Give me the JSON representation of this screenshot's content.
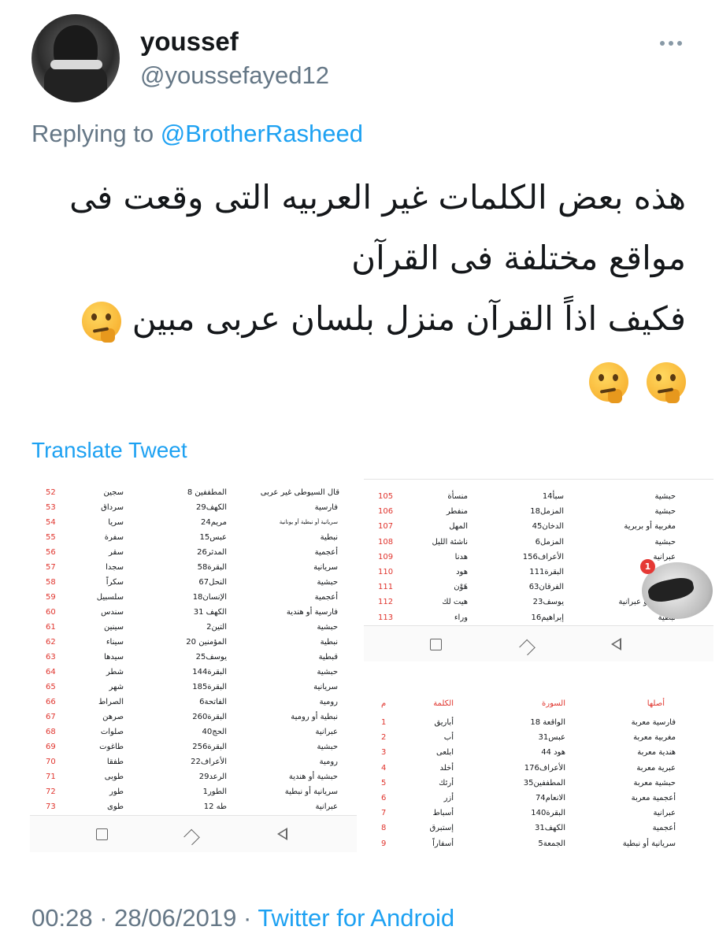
{
  "header": {
    "name": "youssef",
    "handle": "@youssefayed12"
  },
  "reply": {
    "prefix": "Replying to",
    "to": "@BrotherRasheed"
  },
  "tweet": {
    "line1": "هذه بعض الكلمات غير العربيه التى وقعت فى",
    "line2": "مواقع مختلفة فى القرآن",
    "line3": "فكيف اذاً القرآن منزل بلسان عربى مبين",
    "emoji": "thinking-face"
  },
  "translate_label": "Translate Tweet",
  "footer": {
    "time": "00:28",
    "date": "28/06/2019",
    "source": "Twitter for Android",
    "separator": "·"
  },
  "shot_left": {
    "header_note": "قال السيوطى غير عربى",
    "rows": [
      {
        "n": "52",
        "w": "سجين",
        "s": "المطففين 8",
        "o": ""
      },
      {
        "n": "53",
        "w": "سرداق",
        "s": "الكهف29",
        "o": "فارسية"
      },
      {
        "n": "54",
        "w": "سريا",
        "s": "مريم24",
        "o": "سريانية أو نبطية أو يونانية"
      },
      {
        "n": "55",
        "w": "سفرة",
        "s": "عبس15",
        "o": "نبطية"
      },
      {
        "n": "56",
        "w": "سقر",
        "s": "المدثر26",
        "o": "أعجمية"
      },
      {
        "n": "57",
        "w": "سجدا",
        "s": "البقرة58",
        "o": "سريانية"
      },
      {
        "n": "58",
        "w": "سكراً",
        "s": "النحل67",
        "o": "حبشية"
      },
      {
        "n": "59",
        "w": "سلسبيل",
        "s": "الإنسان18",
        "o": "أعجمية"
      },
      {
        "n": "60",
        "w": "سندس",
        "s": "الكهف 31",
        "o": "فارسية أو هندية"
      },
      {
        "n": "61",
        "w": "سينين",
        "s": "التين2",
        "o": "حبشية"
      },
      {
        "n": "62",
        "w": "سيناء",
        "s": "المؤمنين 20",
        "o": "نبطية"
      },
      {
        "n": "63",
        "w": "سيدها",
        "s": "يوسف25",
        "o": "قبطية"
      },
      {
        "n": "64",
        "w": "شطر",
        "s": "البقرة144",
        "o": "حبشية"
      },
      {
        "n": "65",
        "w": "شهر",
        "s": "البقرة185",
        "o": "سريانية"
      },
      {
        "n": "66",
        "w": "الصراط",
        "s": "الفاتحة6",
        "o": "رومية"
      },
      {
        "n": "67",
        "w": "صرهن",
        "s": "البقرة260",
        "o": "نبطية أو رومية"
      },
      {
        "n": "68",
        "w": "صلوات",
        "s": "الحج40",
        "o": "عبرانية"
      },
      {
        "n": "69",
        "w": "طاغوت",
        "s": "البقرة256",
        "o": "حبشية"
      },
      {
        "n": "70",
        "w": "طفقا",
        "s": "الأعراف22",
        "o": "رومية"
      },
      {
        "n": "71",
        "w": "طوبى",
        "s": "الرعد29",
        "o": "حبشية أو هندية"
      },
      {
        "n": "72",
        "w": "طور",
        "s": "الطور1",
        "o": "سريانية أو نبطية"
      },
      {
        "n": "73",
        "w": "طوى",
        "s": "طه 12",
        "o": "عبرانية"
      }
    ]
  },
  "shot_top_right": {
    "rows": [
      {
        "n": "105",
        "w": "منسأة",
        "s": "سبأ14",
        "o": "حبشية"
      },
      {
        "n": "106",
        "w": "منفطر",
        "s": "المزمل18",
        "o": "حبشية"
      },
      {
        "n": "107",
        "w": "المهل",
        "s": "الدخان45",
        "o": "مغربية أو بربرية"
      },
      {
        "n": "108",
        "w": "ناشئة الليل",
        "s": "المزمل6",
        "o": "حبشية"
      },
      {
        "n": "109",
        "w": "هدنا",
        "s": "الأعراف156",
        "o": "عبرانية"
      },
      {
        "n": "110",
        "w": "هود",
        "s": "البقرة111",
        "o": "عبرانية"
      },
      {
        "n": "111",
        "w": "هَوْن",
        "s": "الفرقان63",
        "o": "سريانية"
      },
      {
        "n": "112",
        "w": "هيت لك",
        "s": "يوسف23",
        "o": "حورانية أو عبرانية"
      },
      {
        "n": "113",
        "w": "وراء",
        "s": "إبراهيم16",
        "o": "نبطية"
      }
    ],
    "notification_count": "1"
  },
  "shot_bottom_right": {
    "headers": {
      "n": "م",
      "w": "الكلمة",
      "s": "السورة",
      "o": "أصلها"
    },
    "rows": [
      {
        "n": "1",
        "w": "أباريق",
        "s": "الواقعة 18",
        "o": "فارسية معربة"
      },
      {
        "n": "2",
        "w": "أب",
        "s": "عبس31",
        "o": "مغربية معربة"
      },
      {
        "n": "3",
        "w": "ابلعى",
        "s": "هود 44",
        "o": "هندية معربة"
      },
      {
        "n": "4",
        "w": "أخلد",
        "s": "الأعراف176",
        "o": "عبرية معربة"
      },
      {
        "n": "5",
        "w": "أرئك",
        "s": "المطففين35",
        "o": "حبشية معربة"
      },
      {
        "n": "6",
        "w": "أزر",
        "s": "الانعام74",
        "o": "أعجمية معربة"
      },
      {
        "n": "7",
        "w": "أسباط",
        "s": "البقرة140",
        "o": "عبرانية"
      },
      {
        "n": "8",
        "w": "إستبرق",
        "s": "الكهف31",
        "o": "أعجمية"
      },
      {
        "n": "9",
        "w": "أسفاراً",
        "s": "الجمعة5",
        "o": "سريانية أو نبطية"
      }
    ]
  }
}
